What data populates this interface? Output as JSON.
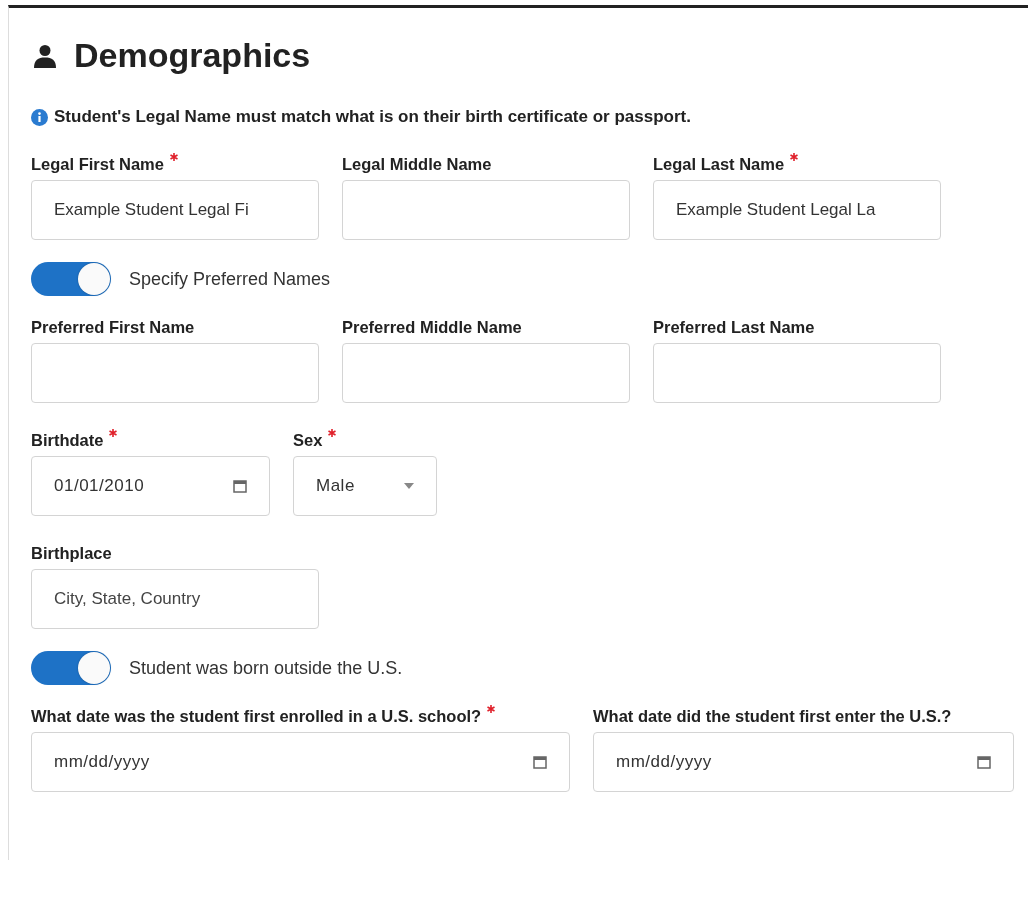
{
  "heading": {
    "title": "Demographics"
  },
  "notice": "Student's Legal Name must match what is on their birth certificate or passport.",
  "rows": [
    {
      "kind": "fields",
      "fields": [
        {
          "kind": "text",
          "label": "Legal First Name",
          "required": true,
          "value": "Example Student Legal Fi"
        },
        {
          "kind": "text",
          "label": "Legal Middle Name",
          "required": false
        },
        {
          "kind": "text",
          "label": "Legal Last Name",
          "required": true,
          "value": "Example Student Legal La"
        }
      ]
    },
    {
      "kind": "toggle",
      "label": "Specify Preferred Names",
      "on": true
    },
    {
      "kind": "fields",
      "fields": [
        {
          "kind": "text",
          "label": "Preferred First Name",
          "required": false
        },
        {
          "kind": "text",
          "label": "Preferred Middle Name",
          "required": false
        },
        {
          "kind": "text",
          "label": "Preferred Last Name",
          "required": false
        }
      ]
    },
    {
      "kind": "fields",
      "fields": [
        {
          "kind": "date",
          "label": "Birthdate",
          "required": true,
          "value": "01/01/2010"
        },
        {
          "kind": "select",
          "label": "Sex",
          "required": true,
          "value": "Male"
        }
      ]
    },
    {
      "kind": "fields",
      "fields": [
        {
          "kind": "text",
          "label": "Birthplace",
          "required": false,
          "placeholder": "City, State, Country"
        }
      ]
    },
    {
      "kind": "toggle",
      "label": "Student was born outside the U.S.",
      "on": true
    },
    {
      "kind": "wide",
      "fields": [
        {
          "kind": "date",
          "label": "What date was the student first enrolled in a U.S. school?",
          "required": true,
          "placeholder": "mm/dd/yyyy"
        },
        {
          "kind": "date",
          "label": "What date did the student first enter the U.S.?",
          "required": false,
          "placeholder": "mm/dd/yyyy"
        }
      ]
    }
  ]
}
